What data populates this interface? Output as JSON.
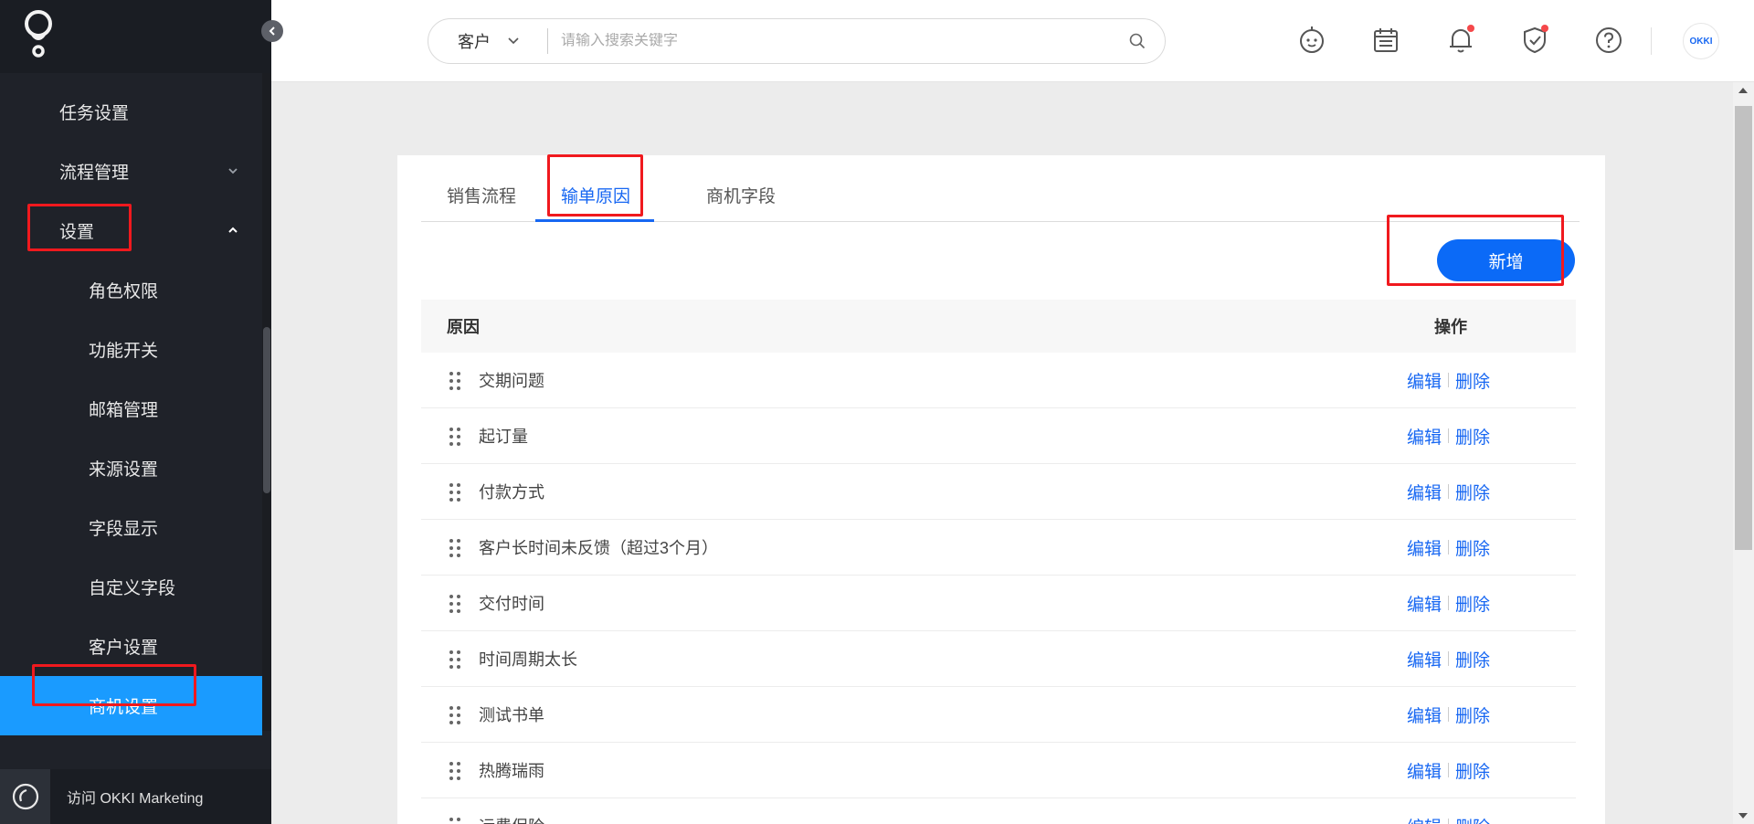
{
  "sidebar": {
    "items": [
      {
        "label": "任务设置",
        "level": 1
      },
      {
        "label": "流程管理",
        "level": 1,
        "expandable": true,
        "expanded": false
      },
      {
        "label": "设置",
        "level": 1,
        "expandable": true,
        "expanded": true
      },
      {
        "label": "角色权限",
        "level": 2
      },
      {
        "label": "功能开关",
        "level": 2
      },
      {
        "label": "邮箱管理",
        "level": 2
      },
      {
        "label": "来源设置",
        "level": 2
      },
      {
        "label": "字段显示",
        "level": 2
      },
      {
        "label": "自定义字段",
        "level": 2
      },
      {
        "label": "客户设置",
        "level": 2
      },
      {
        "label": "商机设置",
        "level": 2,
        "active": true
      }
    ],
    "footer_label": "访问 OKKI Marketing"
  },
  "header": {
    "search": {
      "category": "客户",
      "placeholder": "请输入搜索关键字"
    },
    "avatar_text": "OKKI",
    "notification_dot_color": "#f5484a"
  },
  "tabs": [
    {
      "label": "销售流程",
      "active": false
    },
    {
      "label": "输单原因",
      "active": true
    },
    {
      "label": "商机字段",
      "active": false
    }
  ],
  "add_button_label": "新增",
  "table": {
    "columns": [
      "原因",
      "操作"
    ],
    "edit_label": "编辑",
    "delete_label": "删除",
    "rows": [
      "交期问题",
      "起订量",
      "付款方式",
      "客户长时间未反馈（超过3个月）",
      "交付时间",
      "时间周期太长",
      "测试书单",
      "热腾瑞雨",
      "运费保险"
    ]
  },
  "colors": {
    "accent": "#1767f2",
    "button": "#0b6af7",
    "sidebar_bg": "#1f2229",
    "sidebar_active": "#1a9bff",
    "annotation": "#f0191e"
  }
}
